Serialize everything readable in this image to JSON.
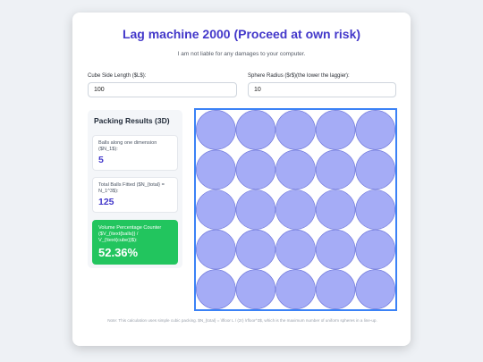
{
  "header": {
    "title": "Lag machine 2000 (Proceed at own risk)",
    "subtitle": "I am not liable for any damages to your computer."
  },
  "inputs": {
    "cube_side": {
      "label": "Cube Side Length ($L$):",
      "value": "100"
    },
    "sphere_radius": {
      "label": "Sphere Radius ($r$)(the lower the laggier):",
      "value": "10"
    }
  },
  "results": {
    "title": "Packing Results (3D)",
    "balls_dimension": {
      "label": "Balls along one dimension ($N_1$):",
      "value": "5"
    },
    "balls_total": {
      "label": "Total Balls Fitted ($N_{total} = N_1^3$):",
      "value": "125"
    },
    "volume_pct": {
      "label": "Volume Percentage Counter ($V_{\\text{balls}} / V_{\\text{cube}}$):",
      "value": "52.36%"
    }
  },
  "visualization": {
    "grid_n": 5,
    "circle_fill": "#a5acf6",
    "circle_stroke": "#6a73d8",
    "border_color": "#3b82f6"
  },
  "note": "Note: This calculation uses simple cubic packing. $N_{total} = \\lfloor L / (2r) \\rfloor^3$, which is the maximum number of uniform spheres in a line-up."
}
